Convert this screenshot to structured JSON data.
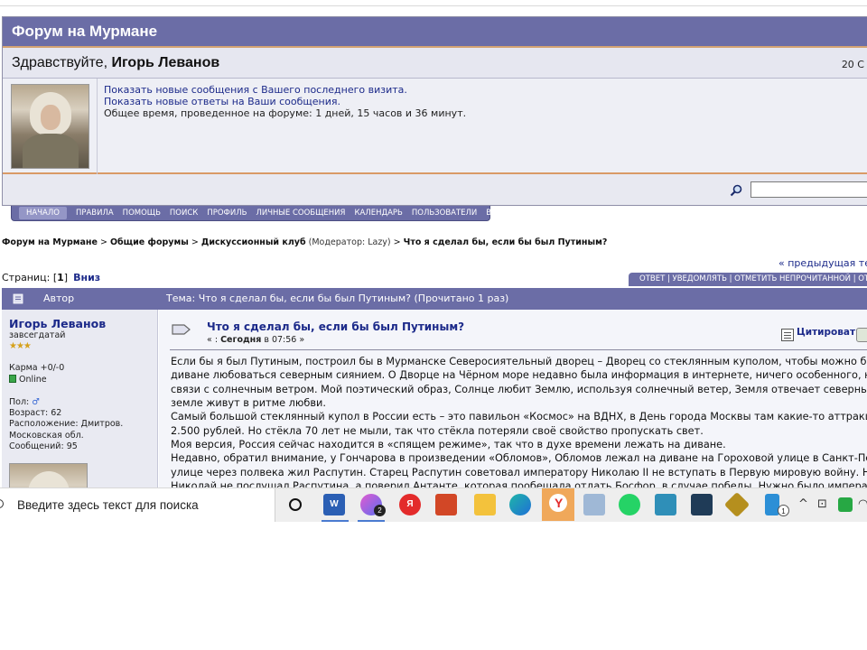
{
  "forum": {
    "title": "Форум на Мурмане",
    "greeting": "Здравствуйте, ",
    "user_name": "Игорь Леванов",
    "date_stub": "20 С",
    "links": [
      "Показать новые сообщения с Вашего последнего визита.",
      "Показать новые ответы на Ваши сообщения."
    ],
    "time_spent": "Общее время, проведенное на форуме: 1 дней, 15 часов и 36 минут."
  },
  "nav": [
    "НАЧАЛО",
    "ПРАВИЛА",
    "ПОМОЩЬ",
    "ПОИСК",
    "ПРОФИЛЬ",
    "ЛИЧНЫЕ СООБЩЕНИЯ",
    "КАЛЕНДАРЬ",
    "ПОЛЬЗОВАТЕЛИ",
    "ВЫЙТИ"
  ],
  "breadcrumb": {
    "b1": "Форум на Мурмане",
    "sep": " > ",
    "b2": "Общие форумы",
    "b3": "Дискуссионный клуб",
    "moderator": " (Модератор: Lazy) ",
    "b4": "Что я сделал бы, если бы был Путиным?"
  },
  "prev_topic": "« предыдущая те",
  "pages": {
    "label": "Страниц: [",
    "current": "1",
    "close": "]",
    "down": "Вниз"
  },
  "actions": "ОТВЕТ  |  УВЕДОМЛЯТЬ  |  ОТМЕТИТЬ НЕПРОЧИТАННОЙ  |  ОТП",
  "topic_header": {
    "author": "Автор",
    "topic": "Тема: Что я сделал бы, если бы был Путиным?  (Прочитано 1 раз)"
  },
  "post": {
    "author": "Игорь Леванов",
    "rank": "завсегдатай",
    "stars": "★★★",
    "karma": "Карма +0/-0",
    "status": "Online",
    "gender_label": "Пол: ",
    "gender_symbol": "♂",
    "age": "Возраст: 62",
    "location1": "Расположение: Дмитров.",
    "location2": "Московская обл.",
    "messages": "Сообщений: 95",
    "title": "Что я сделал бы, если бы был Путиным?",
    "date_prefix": "« : ",
    "date_day": "Сегодня",
    "date_time": " в 07:56 »",
    "quote": "Цитировать",
    "body": [
      "Если бы я был Путиным, построил бы в Мурманске Северосиятельный дворец – Дворец со стеклянным куполом, чтобы можно бы",
      "диване любоваться северным сиянием.  О Дворце на Чёрном море недавно была информация в интернете, ничего особенного, ни",
      "связи с солнечным ветром. Мой поэтический образ, Солнце любит Землю, используя солнечный ветер, Земля отвечает северным",
      "земле живут в ритме любви.",
      "Самый большой стеклянный купол в России есть – это павильон «Космос» на ВДНХ, в День города Москвы там какие-то аттракци",
      "2.500 рублей.  Но стёкла 70 лет не мыли, так что стёкла потеряли своё свойство пропускать свет.",
      "Моя версия, Россия сейчас находится в «спящем режиме», так что в духе времени лежать на диване.",
      "Недавно, обратил внимание, у Гончарова в произведении «Обломов», Обломов лежал на диване на Гороховой улице в Санкт-Пет",
      "улице через полвека жил Распутин. Старец Распутин  советовал императору Николаю II не вступать в Первую мировую войну. Н",
      "Николай не послушал Распутина, а поверил Антанте, которая пообещала  отдать Босфор, в случае победы. Нужно было императ"
    ]
  },
  "taskbar": {
    "search_placeholder": "Введите здесь текст для поиска",
    "word_label": "W",
    "badge1": "2",
    "yandex_label": "Я",
    "badge2": "1"
  }
}
